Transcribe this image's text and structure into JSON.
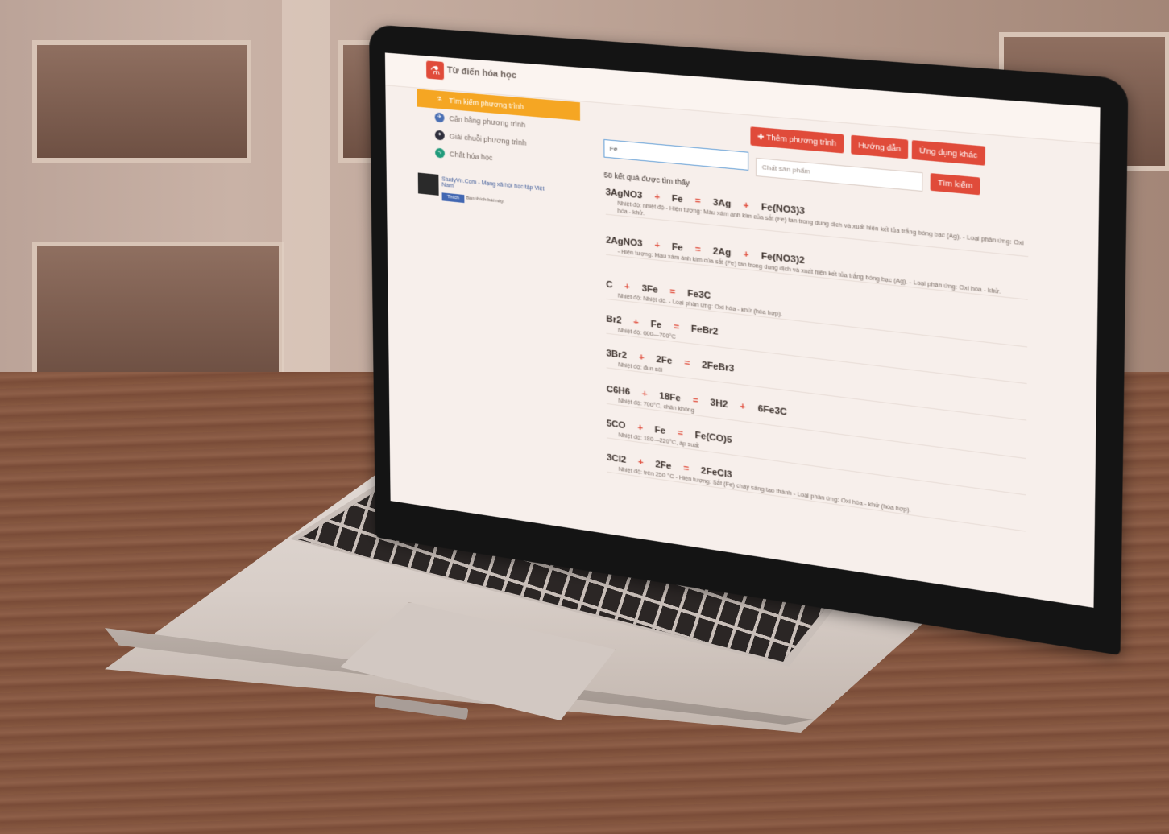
{
  "app": {
    "title": "Từ điển hóa học"
  },
  "sidebar": {
    "items": [
      {
        "label": "Tìm kiếm phương trình",
        "active": true,
        "icon": "flask-icon"
      },
      {
        "label": "Cân bằng phương trình",
        "icon": "balance-icon"
      },
      {
        "label": "Giải chuỗi phương trình",
        "icon": "chain-icon"
      },
      {
        "label": "Chất hóa học",
        "icon": "molecule-icon"
      }
    ],
    "fb": {
      "title": "StudyVn.Com - Mạng xã hội học tập Việt Nam",
      "like": "Thích",
      "count": "Bạn thích bài này."
    }
  },
  "toolbar": {
    "add_label": "✚ Thêm phương trình",
    "guide_label": "Hướng dẫn",
    "apps_label": "Ứng dụng khác",
    "search_label": "Tìm kiếm"
  },
  "search": {
    "reactant_value": "Fe",
    "product_placeholder": "Chất sản phẩm"
  },
  "results": {
    "count_text": "58 kết quả được tìm thấy",
    "equations": [
      {
        "terms": [
          "3AgNO3",
          "+",
          "Fe",
          "=",
          "3Ag",
          "+",
          "Fe(NO3)3"
        ],
        "note": "Nhiệt độ: nhiệt độ - Hiện tượng: Màu xám ánh kim của sắt (Fe) tan trong dung dịch và xuất hiện kết tủa trắng bóng bạc (Ag). - Loại phản ứng: Oxi hóa - khử."
      },
      {
        "terms": [
          "2AgNO3",
          "+",
          "Fe",
          "=",
          "2Ag",
          "+",
          "Fe(NO3)2"
        ],
        "note": "- Hiện tượng: Màu xám ánh kim của sắt (Fe) tan trong dung dịch và xuất hiện kết tủa trắng bóng bạc (Ag). - Loại phản ứng: Oxi hóa - khử."
      },
      {
        "terms": [
          "C",
          "+",
          "3Fe",
          "=",
          "Fe3C"
        ],
        "note": "Nhiệt độ: Nhiệt độ. - Loại phản ứng: Oxi hóa - khử (hóa hợp)."
      },
      {
        "terms": [
          "Br2",
          "+",
          "Fe",
          "=",
          "FeBr2"
        ],
        "note": "Nhiệt độ: 600—700°C"
      },
      {
        "terms": [
          "3Br2",
          "+",
          "2Fe",
          "=",
          "2FeBr3"
        ],
        "note": "Nhiệt độ: đun sôi"
      },
      {
        "terms": [
          "C6H6",
          "+",
          "18Fe",
          "=",
          "3H2",
          "+",
          "6Fe3C"
        ],
        "note": "Nhiệt độ: 700°C, chân không"
      },
      {
        "terms": [
          "5CO",
          "+",
          "Fe",
          "=",
          "Fe(CO)5"
        ],
        "note": "Nhiệt độ: 180—220°C, áp suất"
      },
      {
        "terms": [
          "3Cl2",
          "+",
          "2Fe",
          "=",
          "2FeCl3"
        ],
        "note": "Nhiệt độ: trên 250 °C - Hiện tượng: Sắt (Fe) cháy sáng tạo thành - Loại phản ứng: Oxi hóa - khử (hóa hợp)."
      }
    ]
  }
}
